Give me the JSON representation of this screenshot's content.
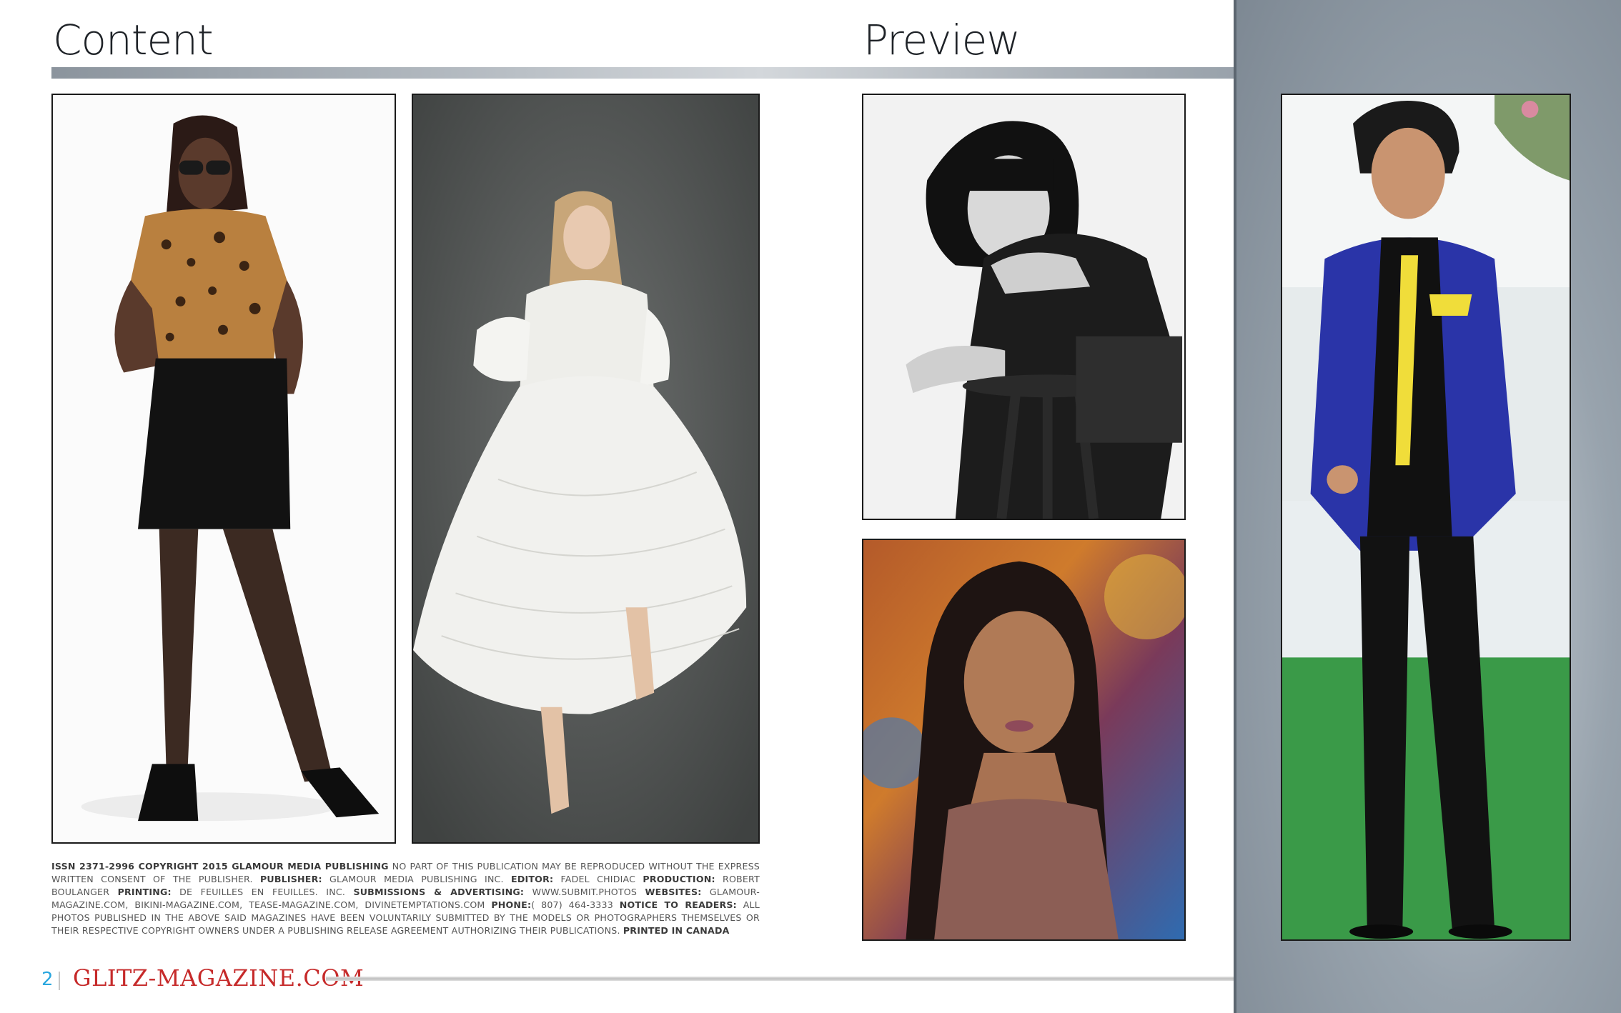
{
  "headings": {
    "content": "Content",
    "preview": "Preview"
  },
  "credits": [
    {
      "b": true,
      "t": "ISSN 2371-2996 Copyright 2015 Glamour Media Publishing"
    },
    {
      "b": false,
      "t": " No part of this publication may be reproduced without the express written consent of the publisher. "
    },
    {
      "b": true,
      "t": "Publisher:"
    },
    {
      "b": false,
      "t": " Glamour Media Publishing Inc. "
    },
    {
      "b": true,
      "t": "Editor:"
    },
    {
      "b": false,
      "t": " Fadel Chidiac "
    },
    {
      "b": true,
      "t": "Production:"
    },
    {
      "b": false,
      "t": " Robert Boulanger "
    },
    {
      "b": true,
      "t": "Printing:"
    },
    {
      "b": false,
      "t": " De Feuilles En Feuilles. Inc. "
    },
    {
      "b": true,
      "t": "Submissions & Advertising:"
    },
    {
      "b": false,
      "t": " www.submit.photos "
    },
    {
      "b": true,
      "t": "Websites:"
    },
    {
      "b": false,
      "t": " glamour-magazine.com, bikini-magazine.com, tease-magazine.com, divinetemptations.com "
    },
    {
      "b": true,
      "t": "Phone:"
    },
    {
      "b": false,
      "t": "( 807) 464-3333 "
    },
    {
      "b": true,
      "t": "Notice to Readers:"
    },
    {
      "b": false,
      "t": " All photos published in the above said magazines have been voluntarily submitted by the models or photographers themselves or their respective copyright owners under a publishing release agreement authorizing their publications. "
    },
    {
      "b": true,
      "t": "Printed in Canada"
    }
  ],
  "footer": {
    "page_number": "2",
    "brand": "GLITZ-MAGAZINE.COM"
  },
  "photos": [
    {
      "id": "woman-leopard-top",
      "alt": "Model in leopard print top, black skirt and sunglasses"
    },
    {
      "id": "woman-white-dress",
      "alt": "Model in white lace dress on grey backdrop"
    },
    {
      "id": "girl-black-white",
      "alt": "Black and white portrait of girl with bob haircut on stool"
    },
    {
      "id": "woman-portrait",
      "alt": "Portrait of woman with long dark hair, colorful background"
    },
    {
      "id": "boy-blue-suit",
      "alt": "Boy in blue suit jacket with yellow tie"
    }
  ],
  "colors": {
    "brand_red": "#c62a2a",
    "page_number_blue": "#2aa7df",
    "panel_grey": "#7d8893"
  }
}
